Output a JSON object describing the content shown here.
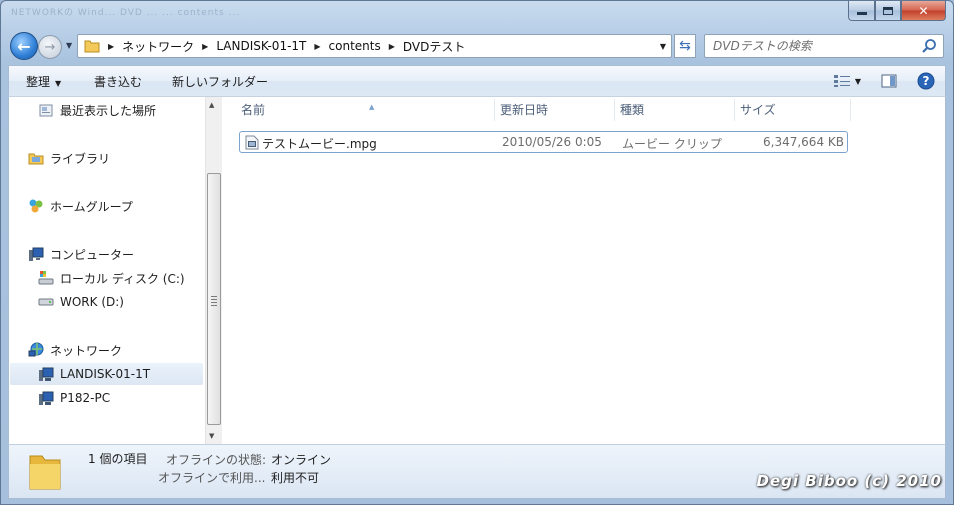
{
  "window": {
    "background_title": "NETWORKの Wind... DVD ... ... contents ... ",
    "buttons": {
      "minimize": "minimize",
      "maximize": "maximize",
      "close": "close"
    }
  },
  "address": {
    "crumbs": [
      "ネットワーク",
      "LANDISK-01-1T",
      "contents",
      "DVDテスト"
    ],
    "search_placeholder": "DVDテストの検索"
  },
  "toolbar": {
    "organize": "整理",
    "burn": "書き込む",
    "new_folder": "新しいフォルダー"
  },
  "nav": {
    "items": [
      {
        "label": "最近表示した場所",
        "icon": "recent-places-icon"
      },
      {
        "label": "ライブラリ",
        "icon": "libraries-icon"
      },
      {
        "label": "ホームグループ",
        "icon": "homegroup-icon"
      },
      {
        "label": "コンピューター",
        "icon": "computer-icon"
      },
      {
        "label": "ローカル ディスク (C:)",
        "icon": "local-disk-icon"
      },
      {
        "label": "WORK (D:)",
        "icon": "drive-icon"
      },
      {
        "label": "ネットワーク",
        "icon": "network-icon"
      },
      {
        "label": "LANDISK-01-1T",
        "icon": "network-computer-icon"
      },
      {
        "label": "P182-PC",
        "icon": "network-computer-icon"
      }
    ]
  },
  "columns": [
    "名前",
    "更新日時",
    "種類",
    "サイズ"
  ],
  "files": [
    {
      "name": "テストムービー.mpg",
      "modified": "2010/05/26 0:05",
      "type": "ムービー クリップ",
      "size": "6,347,664 KB"
    }
  ],
  "status": {
    "count": "1 個の項目",
    "offline_status_label": "オフラインの状態:",
    "offline_status_value": "オンライン",
    "offline_use_label": "オフラインで利用...",
    "offline_use_value": "利用不可"
  },
  "watermark": "Degi Biboo (c) 2010",
  "colors": {
    "selection": "#7da2ce",
    "accent": "#3a72b5"
  }
}
